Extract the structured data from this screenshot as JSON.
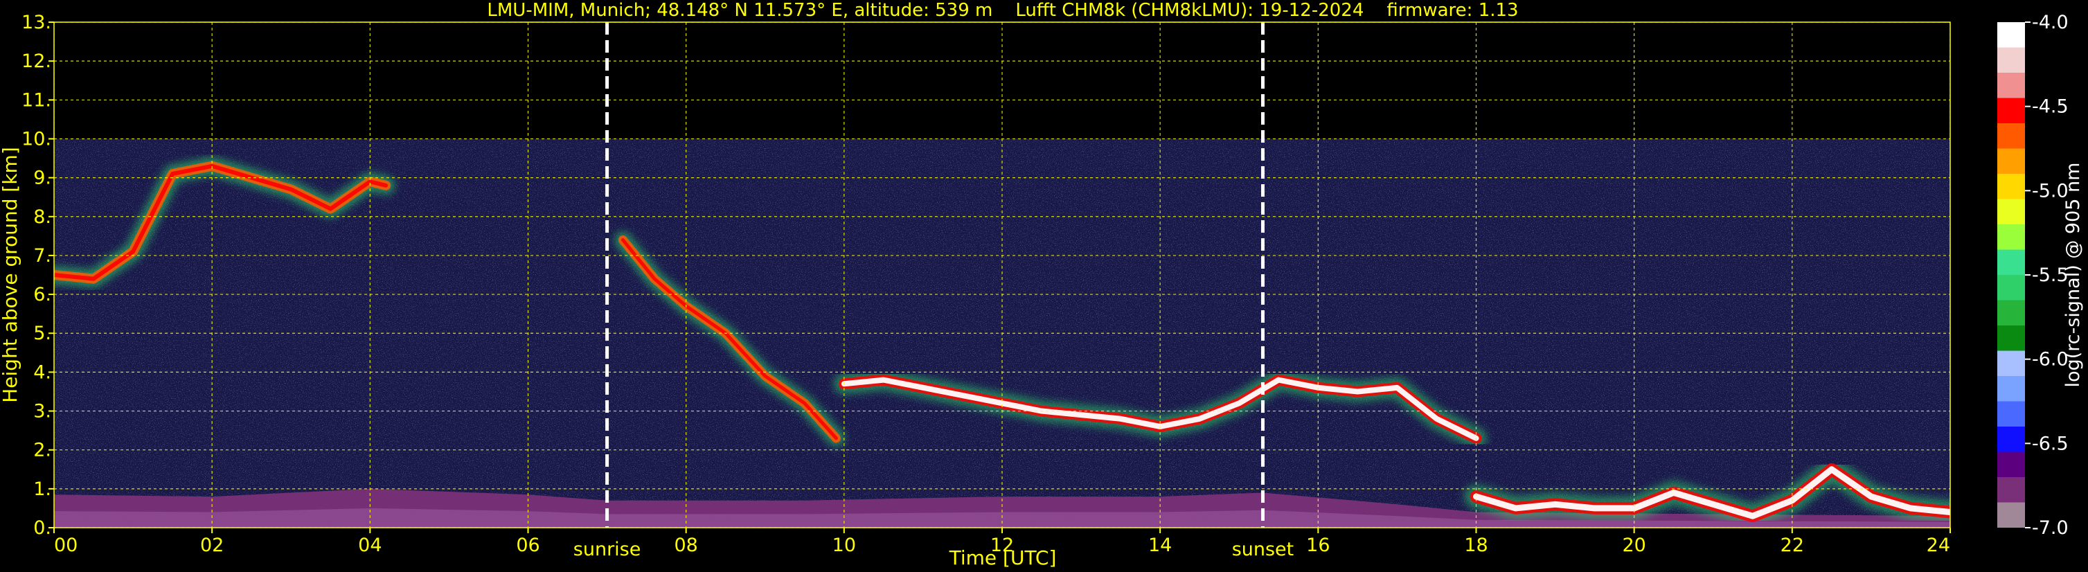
{
  "chart_data": {
    "type": "heatmap",
    "title": "LMU-MIM, Munich; 48.148° N 11.573° E, altitude: 539 m    Lufft CHM8k (CHM8kLMU): 19-12-2024    firmware: 1.13",
    "xlabel": "Time [UTC]",
    "ylabel": "Height above ground [km]",
    "xlim": [
      0,
      24
    ],
    "ylim": [
      0,
      13
    ],
    "x_ticks": [
      "00",
      "02",
      "04",
      "06",
      "08",
      "10",
      "12",
      "14",
      "16",
      "18",
      "20",
      "22",
      "24"
    ],
    "y_ticks": [
      "0.",
      "1.",
      "2.",
      "3.",
      "4.",
      "5.",
      "6.",
      "7.",
      "8.",
      "9.",
      "10.",
      "11.",
      "12.",
      "13."
    ],
    "grid": true,
    "data_max_height_km": 10,
    "events": [
      {
        "name": "sunrise",
        "time_utc": 7.0
      },
      {
        "name": "sunset",
        "time_utc": 15.3
      }
    ],
    "colorbar": {
      "label": "log(rc-signal) @ 905 nm",
      "range": [
        -7.0,
        -4.0
      ],
      "ticks": [
        "-4.0",
        "-4.5",
        "-5.0",
        "-5.5",
        "-6.0",
        "-6.5",
        "-7.0"
      ],
      "colors": [
        "#a08898",
        "#7a3078",
        "#5c0080",
        "#1010ff",
        "#4a6aff",
        "#7aa2ff",
        "#a8c0ff",
        "#0a8a10",
        "#27b43a",
        "#2fd06a",
        "#38e090",
        "#9aff3a",
        "#e8ff20",
        "#ffd800",
        "#ffa000",
        "#ff5a00",
        "#ff0000",
        "#f09090",
        "#f2d0d0",
        "#ffffff"
      ]
    },
    "background_color": "#181848",
    "layers": [
      {
        "name": "boundary-layer",
        "points": [
          [
            0,
            0.85
          ],
          [
            2,
            0.8
          ],
          [
            4,
            1.0
          ],
          [
            6,
            0.85
          ],
          [
            7,
            0.7
          ],
          [
            9.5,
            0.7
          ],
          [
            12,
            0.8
          ],
          [
            14,
            0.8
          ],
          [
            15.3,
            0.9
          ],
          [
            17,
            0.6
          ],
          [
            18,
            0.4
          ],
          [
            24,
            0.3
          ]
        ]
      },
      {
        "name": "cirrus-early",
        "points": [
          [
            0,
            6.5
          ],
          [
            0.5,
            6.4
          ],
          [
            1,
            7.1
          ],
          [
            1.5,
            9.1
          ],
          [
            2,
            9.3
          ],
          [
            2.5,
            9.0
          ],
          [
            3,
            8.7
          ],
          [
            3.5,
            8.2
          ],
          [
            4,
            8.9
          ],
          [
            4.2,
            8.8
          ]
        ]
      },
      {
        "name": "cirrus-fall",
        "points": [
          [
            7.2,
            7.4
          ],
          [
            7.6,
            6.4
          ],
          [
            8,
            5.7
          ],
          [
            8.5,
            5.0
          ],
          [
            9,
            3.9
          ],
          [
            9.5,
            3.2
          ],
          [
            9.9,
            2.3
          ]
        ]
      },
      {
        "name": "mid-cloud",
        "points": [
          [
            10,
            3.7
          ],
          [
            10.5,
            3.8
          ],
          [
            11,
            3.6
          ],
          [
            11.5,
            3.4
          ],
          [
            12,
            3.2
          ],
          [
            12.5,
            3.0
          ],
          [
            13,
            2.9
          ],
          [
            13.5,
            2.8
          ],
          [
            14,
            2.6
          ],
          [
            14.5,
            2.8
          ],
          [
            15,
            3.2
          ],
          [
            15.5,
            3.8
          ],
          [
            16,
            3.6
          ],
          [
            16.5,
            3.5
          ],
          [
            17,
            3.6
          ],
          [
            17.5,
            2.8
          ],
          [
            18,
            2.3
          ]
        ]
      },
      {
        "name": "low-cloud-night",
        "points": [
          [
            18,
            0.8
          ],
          [
            18.5,
            0.5
          ],
          [
            19,
            0.6
          ],
          [
            19.5,
            0.5
          ],
          [
            20,
            0.5
          ],
          [
            20.5,
            0.9
          ],
          [
            21,
            0.6
          ],
          [
            21.5,
            0.3
          ],
          [
            22,
            0.7
          ],
          [
            22.5,
            1.5
          ],
          [
            23,
            0.8
          ],
          [
            23.5,
            0.5
          ],
          [
            24,
            0.4
          ]
        ]
      }
    ]
  }
}
